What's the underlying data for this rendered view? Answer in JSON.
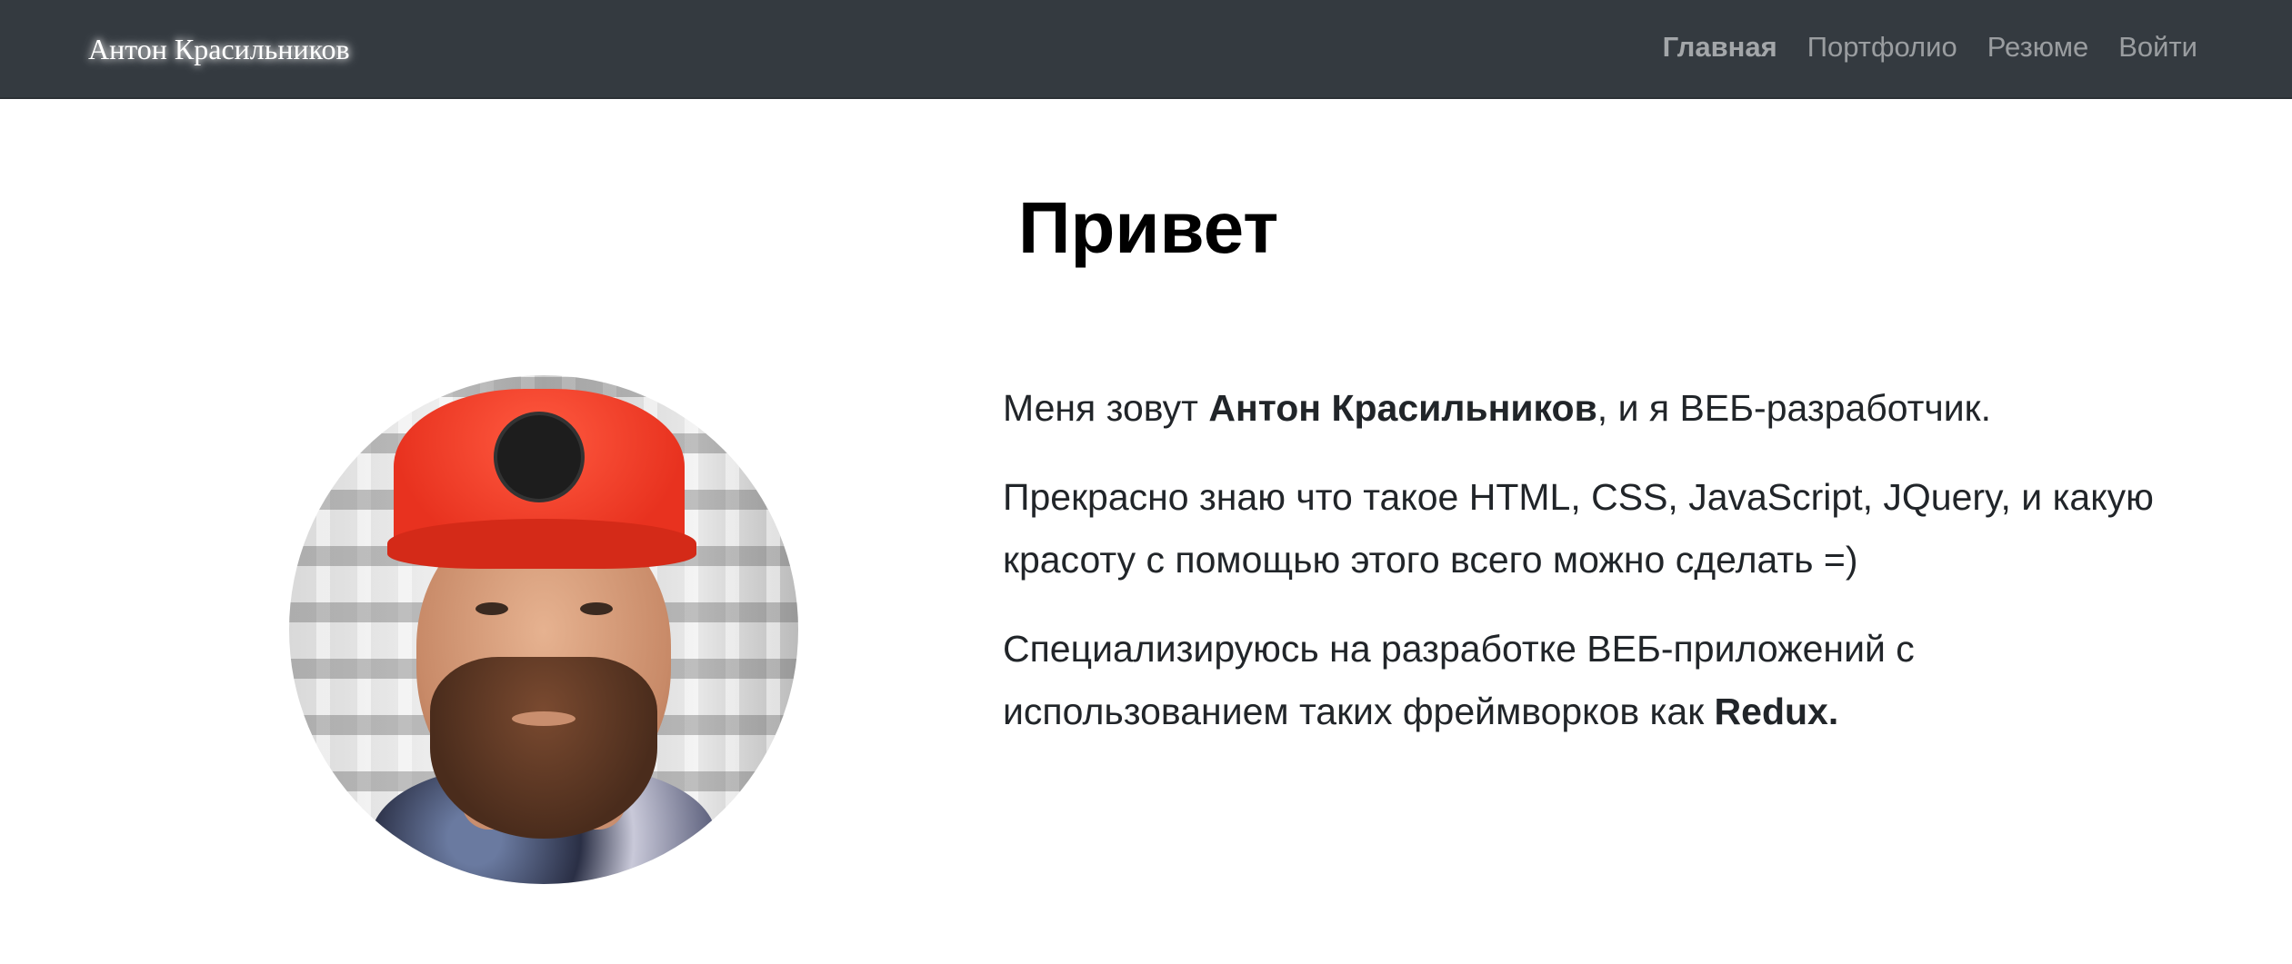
{
  "navbar": {
    "brand": "Антон Красильников",
    "items": [
      {
        "label": "Главная",
        "active": true
      },
      {
        "label": "Портфолио"
      },
      {
        "label": "Резюме"
      },
      {
        "label": "Войти"
      }
    ]
  },
  "main": {
    "heading": "Привет",
    "paragraphs": [
      {
        "before": "Меня зовут ",
        "bold": "Антон Красильников",
        "after": ", и я ВЕБ-разработчик."
      },
      {
        "text": "Прекрасно знаю что такое HTML, CSS, JavaScript, JQuery, и какую красоту с помощью этого всего можно сделать =)"
      },
      {
        "before": "Специализируюсь на разработке ВЕБ-приложений с использованием таких фреймворков как ",
        "bold": "Redux."
      }
    ]
  },
  "colors": {
    "navbar": "#343a40",
    "text": "#212529"
  }
}
